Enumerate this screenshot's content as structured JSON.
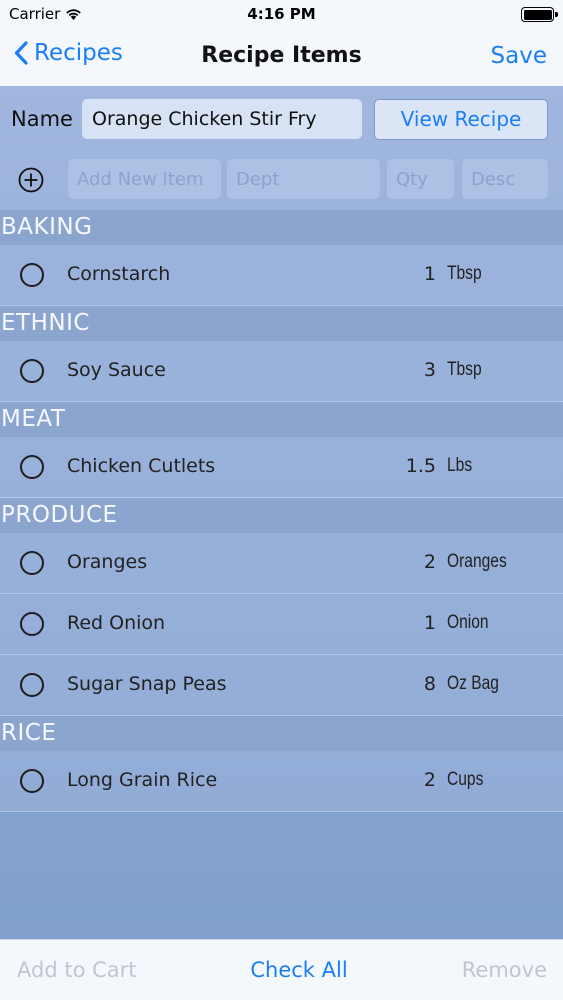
{
  "status_bar": {
    "carrier": "Carrier",
    "time": "4:16 PM"
  },
  "nav": {
    "back_label": "Recipes",
    "title": "Recipe Items",
    "save_label": "Save"
  },
  "form": {
    "name_label": "Name",
    "name_value": "Orange Chicken Stir Fry",
    "view_recipe_label": "View Recipe",
    "add_item_placeholder": "Add New Item",
    "dept_placeholder": "Dept",
    "qty_placeholder": "Qty",
    "desc_placeholder": "Desc"
  },
  "sections": [
    {
      "title": "BAKING",
      "items": [
        {
          "name": "Cornstarch",
          "qty": "1",
          "unit": "Tbsp"
        }
      ]
    },
    {
      "title": "ETHNIC",
      "items": [
        {
          "name": "Soy Sauce",
          "qty": "3",
          "unit": "Tbsp"
        }
      ]
    },
    {
      "title": "MEAT",
      "items": [
        {
          "name": "Chicken Cutlets",
          "qty": "1.5",
          "unit": "Lbs"
        }
      ]
    },
    {
      "title": "PRODUCE",
      "items": [
        {
          "name": "Oranges",
          "qty": "2",
          "unit": "Oranges"
        },
        {
          "name": "Red Onion",
          "qty": "1",
          "unit": "Onion"
        },
        {
          "name": "Sugar Snap Peas",
          "qty": "8",
          "unit": "Oz Bag"
        }
      ]
    },
    {
      "title": "RICE",
      "items": [
        {
          "name": "Long Grain Rice",
          "qty": "2",
          "unit": "Cups"
        }
      ]
    }
  ],
  "toolbar": {
    "add_to_cart": "Add to Cart",
    "check_all": "Check All",
    "remove": "Remove"
  },
  "colors": {
    "accent": "#1a7ef7",
    "disabled": "#bfc6d2",
    "section_bg": "#8ca5cf"
  }
}
